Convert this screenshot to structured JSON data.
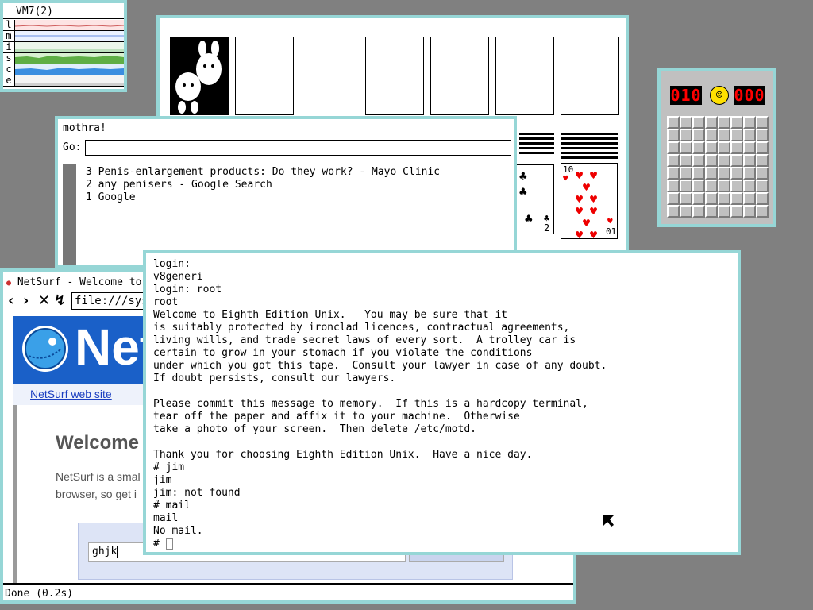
{
  "stats": {
    "title": "VM7(2)",
    "rows": [
      "l",
      "m",
      "i",
      "s",
      "c",
      "e"
    ]
  },
  "minesweeper": {
    "mines_left": "010",
    "timer": "000"
  },
  "history_window": {
    "hostname": "mothra!",
    "go_label": "Go:",
    "go_value": "",
    "entries": [
      "3 Penis-enlargement products: Do they work? - Mayo Clinic",
      "2 any penisers - Google Search",
      "1 Google"
    ]
  },
  "netsurf": {
    "title": "NetSurf - Welcome to",
    "url": "file:///sys/",
    "logo_text": "Net",
    "web_site_link": "NetSurf web site",
    "welcome_heading": "Welcome",
    "body_line1": "NetSurf is a smal",
    "body_line2": "browser, so get i",
    "search_value": "ghjk",
    "status": "Done (0.2s)"
  },
  "terminal": {
    "lines": [
      "login: ",
      "v8generi",
      "login: root",
      "root",
      "Welcome to Eighth Edition Unix.   You may be sure that it",
      "is suitably protected by ironclad licences, contractual agreements,",
      "living wills, and trade secret laws of every sort.  A trolley car is",
      "certain to grow in your stomach if you violate the conditions",
      "under which you got this tape.  Consult your lawyer in case of any doubt.",
      "If doubt persists, consult our lawyers.",
      "",
      "Please commit this message to memory.  If this is a hardcopy terminal,",
      "tear off the paper and affix it to your machine.  Otherwise",
      "take a photo of your screen.  Then delete /etc/motd.",
      "",
      "Thank you for choosing Eighth Edition Unix.  Have a nice day.",
      "# jim",
      "jim",
      "jim: not found",
      "# mail",
      "mail",
      "No mail.",
      "# "
    ]
  },
  "solitaire": {
    "card1_rank": "2",
    "card2_rank": "10",
    "card2_rank_bottom": "01"
  }
}
